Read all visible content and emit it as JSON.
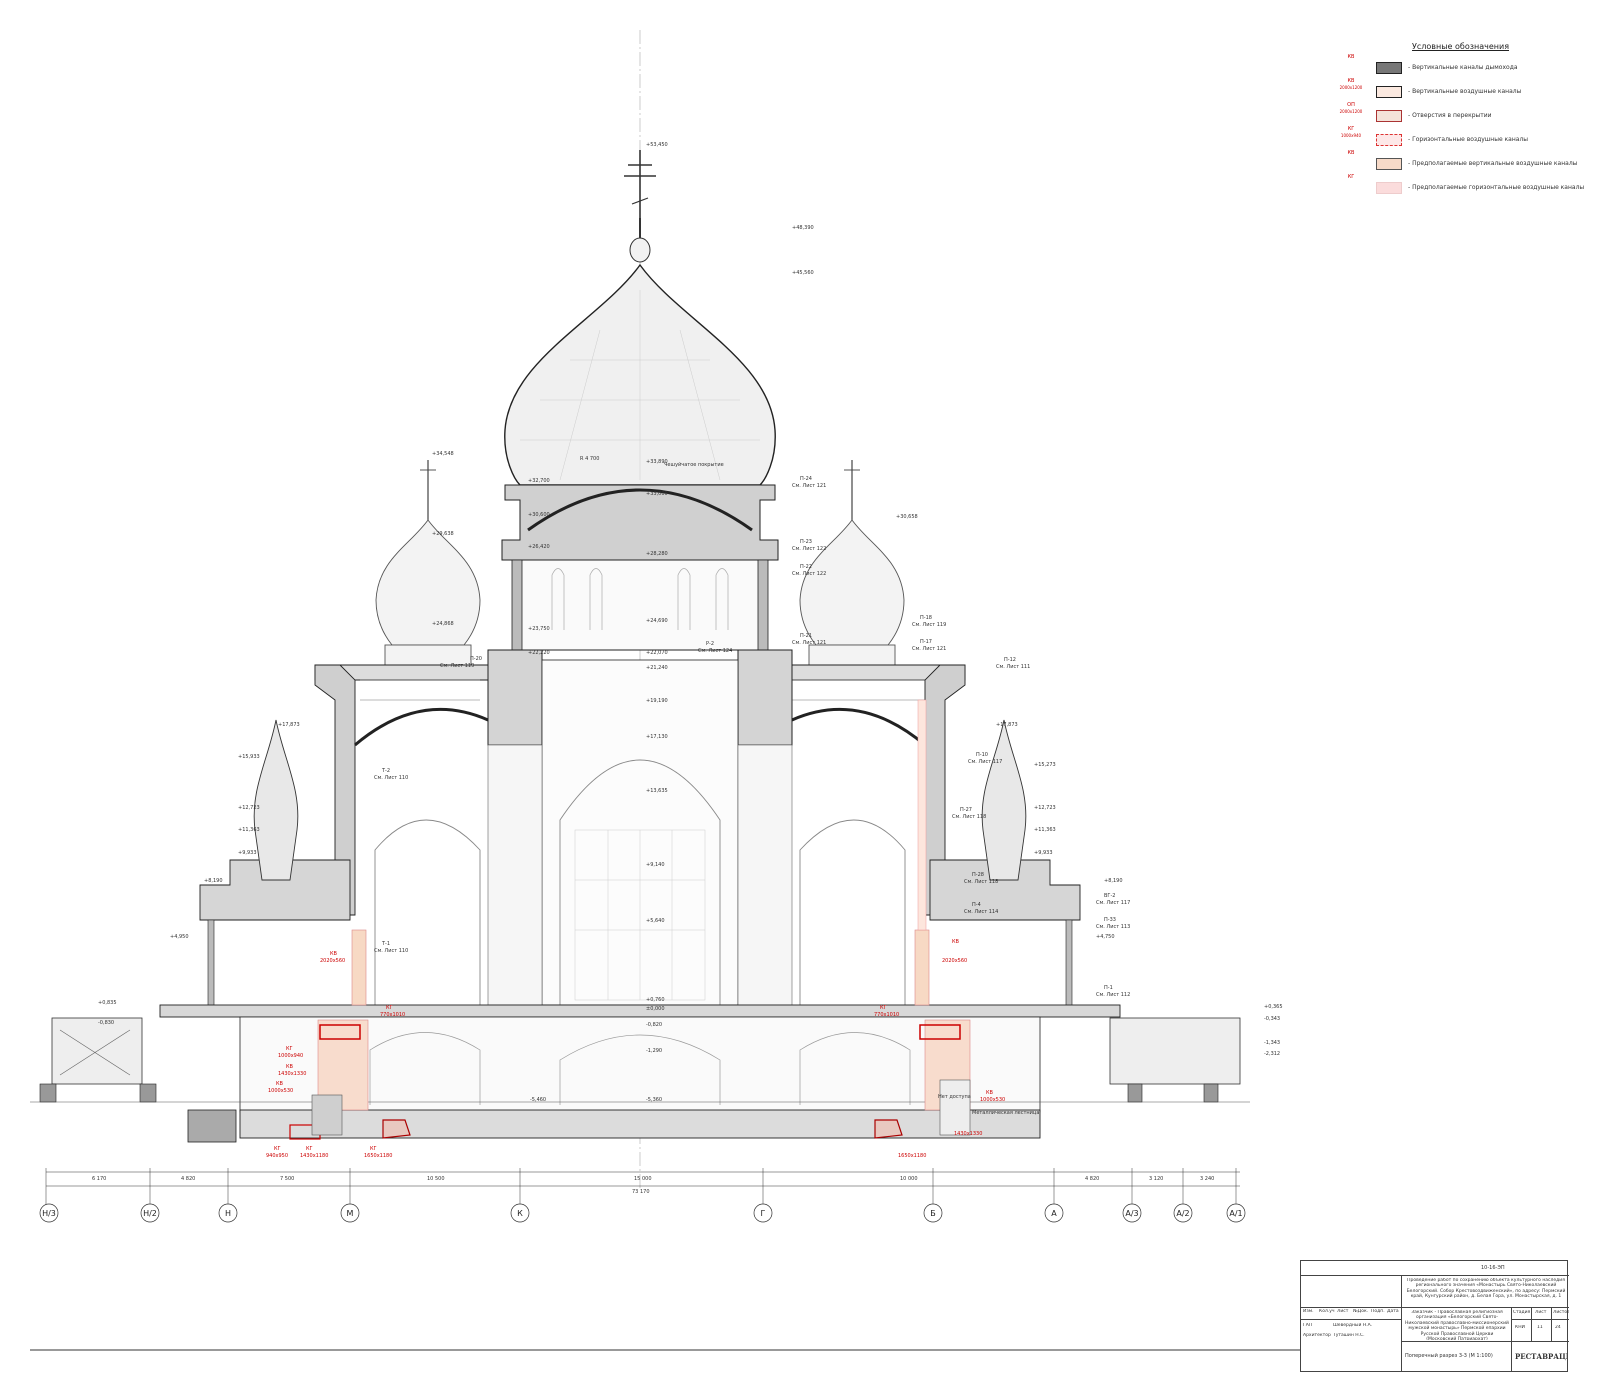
{
  "legend": {
    "title": "Условные обозначения",
    "items": [
      {
        "code": "КВ",
        "size": "",
        "text": "- Вертикальные каналы дымохода",
        "symbol": "dark"
      },
      {
        "code": "КВ",
        "size": "2000х1200",
        "text": "- Вертикальные воздушные каналы",
        "symbol": "light"
      },
      {
        "code": "ОП",
        "size": "2000х1200",
        "text": "- Отверстия в перекрытии",
        "symbol": "hatched"
      },
      {
        "code": "КГ",
        "size": "1000х940",
        "text": "- Горизонтальные воздушные каналы",
        "symbol": "dashed"
      },
      {
        "code": "КВ",
        "size": "",
        "text": "- Предполагаемые вертикальные воздушные каналы",
        "symbol": "peach"
      },
      {
        "code": "КГ",
        "size": "",
        "text": "- Предполагаемые горизонтальные воздушные каналы",
        "symbol": "pink"
      }
    ]
  },
  "elevations": {
    "cross_top": "+53,450",
    "apple_top": "+48,390",
    "cupola": "+45,560",
    "dome_top": "+33,890",
    "dome_base": "+33,000",
    "drum_top": "+32,700",
    "drum_mid": "+30,600",
    "drum_window": "+28,280",
    "drum_low": "+26,420",
    "drum_base": "+24,690",
    "l_dome": "+23,750",
    "roof_l": "+22,220",
    "roof_c": "+22,070",
    "roof_c2": "+21,240",
    "vault_c": "+19,190",
    "vault_c2": "+17,130",
    "arch_c": "+13,635",
    "nave_mid": "+9,140",
    "nave_low": "+5,640",
    "floor": "±0,000",
    "floor2": "+0,760",
    "crypt_top": "-0,820",
    "crypt": "-1,290",
    "crypt_low": "-5,360",
    "crypt_floor": "-5,460",
    "ground": "-6,000",
    "sm_cross_l": "+34,548",
    "sm_cross_r": "+30,658",
    "sm_a": "+29,638",
    "sm_b": "+24,868",
    "left_1": "+15,933",
    "left_2": "+17,873",
    "left_3": "+12,723",
    "left_4": "+11,363",
    "left_5": "+9,933",
    "left_6": "+8,190",
    "left_7": "+4,950",
    "right_1": "+15,273",
    "right_2": "+17,873",
    "right_3": "+12,723",
    "right_4": "+11,363",
    "right_5": "+9,933",
    "right_6": "+8,190",
    "right_7": "+4,750",
    "far_l1": "+0,835",
    "far_l2": "-0,830",
    "far_r1": "+0,365",
    "far_r2": "-0,343",
    "far_r3": "-1,343",
    "far_r4": "-2,312"
  },
  "callouts": {
    "radius": "R 4 700",
    "chapel": "Чешуйчатое покрытие",
    "p24": "П-24",
    "p24_ref": "См. Лист 121",
    "p23": "П-23",
    "p23_ref": "См. Лист 122",
    "p22": "П-22",
    "p22_ref": "См. Лист 122",
    "p21": "П-21",
    "p21_ref": "См. Лист 121",
    "p2": "Р-2",
    "p2_ref": "См. Лист 124",
    "p18": "П-18",
    "p18_ref": "См. Лист 119",
    "p17": "П-17",
    "p17_ref": "См. Лист 121",
    "p12": "П-12",
    "p12_ref": "См. Лист 111",
    "p20": "П-20",
    "p20_ref": "См. Лист 119",
    "t2": "Т-2",
    "t2_ref": "См. Лист 110",
    "t1": "Т-1",
    "t1_ref": "См. Лист 110",
    "p10": "П-10",
    "p10_ref": "См. Лист 117",
    "p27": "П-27",
    "p27_ref": "См. Лист 118",
    "p28": "П-28",
    "p28_ref": "См. Лист 118",
    "p4": "П-4",
    "p4_ref": "См. Лист 114",
    "p33": "П-33",
    "p33_ref": "См. Лист 113",
    "vg2": "ВГ-2",
    "vg2_ref": "См. Лист 117",
    "p1": "П-1",
    "p1_ref": "См. Лист 112",
    "stair": "Металлическая лестница",
    "note": "Нет доступа"
  },
  "ducts": {
    "kv_l": "КВ",
    "kv_l_size": "2020х560",
    "kv_r": "КВ",
    "kv_r_size": "2020х560",
    "kg_l": "КГ",
    "kg_l_size": "770х1010",
    "kg_r": "КГ",
    "kg_r_size": "770х1010",
    "kg1": "КГ",
    "kg1_size": "1000х940",
    "kv2": "КВ",
    "kv2_size": "1430х1330",
    "kv3": "КВ",
    "kv3_size": "1000х530",
    "kg2": "КГ",
    "kg2_size": "940х950",
    "kg3": "КГ",
    "kg3_size": "1430х1180",
    "kg4": "КГ",
    "kg4_size": "1650х1180",
    "kg5_size": "1650х1180",
    "kv4_size": "1430х1330",
    "kv5": "КВ",
    "kv5_size": "1000х530"
  },
  "dimensions": {
    "d1": "6 170",
    "d2": "4 820",
    "d3": "7 500",
    "d4": "10 500",
    "d5": "15 000",
    "d6": "10 000",
    "d7": "4 820",
    "d8": "3 120",
    "d9": "3 240",
    "total": "73 170"
  },
  "axes": [
    "Н/3",
    "Н/2",
    "Н",
    "М",
    "К",
    "Г",
    "Б",
    "А",
    "А/3",
    "А/2",
    "А/1"
  ],
  "title_block": {
    "code": "10-16-ЭП",
    "description": "Проведение работ по сохранению объекта культурного наследия регионального значения «Монастырь Свято-Николаевский Белогорский. Собор Крестовоздвиженский», по адресу: Пермский край, Кунгурский район, д. Белая Гора, ул. Монастырская, д. 1",
    "client": "Заказчик - Православная религиозная организация «Белогорский Свято-Николаевский православно-миссионерский мужской монастырь» Пермской епархии Русской Православной Церкви (Московский Патриархат)",
    "sheet_title": "Поперечный разрез 3-3 (М 1:100)",
    "stage_label": "Стадия",
    "sheet_label": "Лист",
    "sheets_label": "Листов",
    "stage": "КНИ",
    "sheet": "11",
    "sheets": "24",
    "hdr_izm": "Изм.",
    "hdr_kol": "Кол.уч",
    "hdr_list": "Лист",
    "hdr_doc": "№Док.",
    "hdr_sign": "Подп.",
    "hdr_date": "Дата",
    "role1": "ГАП",
    "name1": "Шевердный Н.А.",
    "role2": "Архитектор",
    "name2": "Туташин Н.С.",
    "company": "РЕСТАВРАЦИЯ"
  }
}
